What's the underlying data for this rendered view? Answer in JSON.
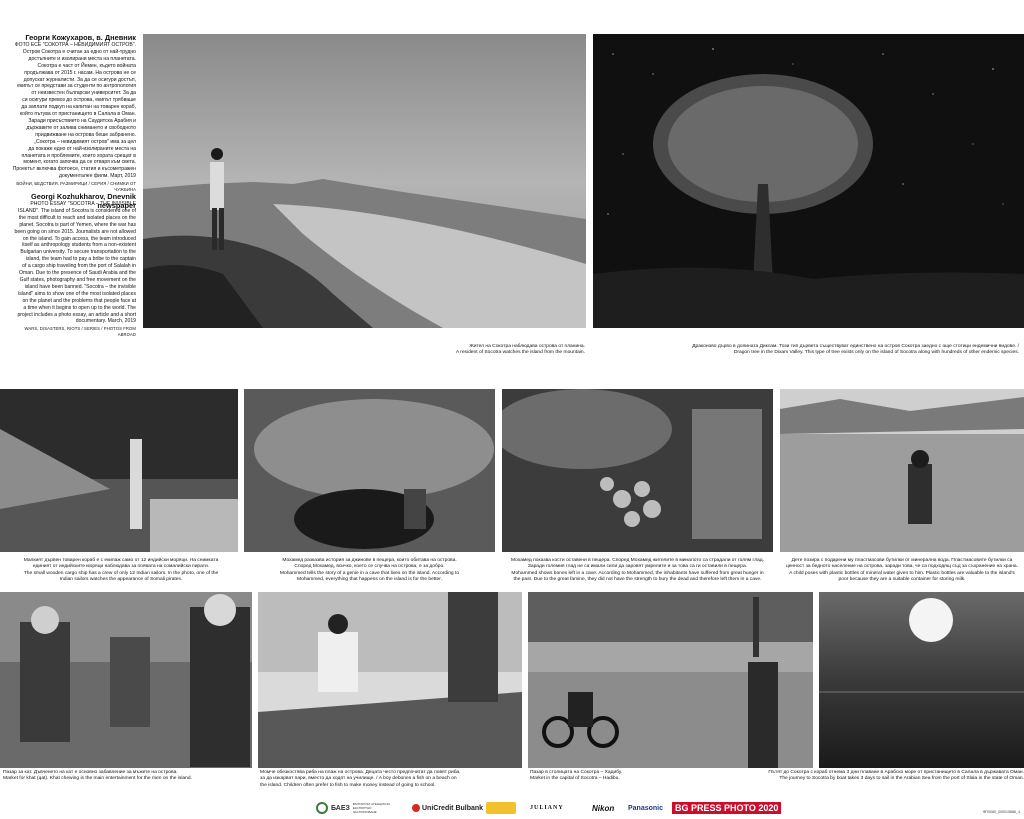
{
  "intro": {
    "bg_title": "Георги Кожухаров, в. Дневник",
    "bg_body": [
      "ФОТО ЕСЕ \"СОКОТРА – НЕВИДИМИЯТ ОСТРОВ\".",
      "Остров Сокотра е считан за едно от най-трудно",
      "достъпните и изолирани места на планетата.",
      "Сокотра е част от Йемен, където войната",
      "продължава от 2015 г. насам. На острова не се",
      "допускат журналисти. За да се осигури достъп,",
      "екипът се представи за студенти по антропология",
      "от неизвестен български университет. За да",
      "си осигури превоз до острова, екипът трябваше",
      "да заплати подкуп на капитан на товарен кораб,",
      "който пътува от пристанището в Салала в Оман.",
      "Заради присъствието на Саудитска Арабия и",
      "държавите от залива снимането и свободното",
      "придвижване на острова беше забранено.",
      "„Сокотра – невидимият остров\" има за цел",
      "да покаже едно от най-изолираните места на",
      "планетата и проблемите, които хората срещат в",
      "момент, когато започва да се отваря към света.",
      "Проектът включва фотоесе, статия и късометражен",
      "документален филм. Март, 2019"
    ],
    "bg_tags": "ВОЙНИ, БЕДСТВИЯ, РАЗМИРИЦИ / СЕРИЯ / СНИМКИ ОТ ЧУЖБИНА",
    "en_title": "Georgi Kozhukharov, Dnevnik newspaper",
    "en_body": [
      "PHOTO ESSAY \"SOCOTRA – THE INVISIBLE",
      "ISLAND\". The island of Socotra is considered one of",
      "the most difficult to reach and isolated places on the",
      "planet. Socotra is part of Yemen, where the war has",
      "been going on since 2015. Journalists are not allowed",
      "on the island. To gain access, the team introduced",
      "itself as anthropology students from a non-existent",
      "Bulgarian university. To secure transportation to the",
      "island, the team had to pay a bribe to the captain",
      "of a cargo ship traveling from the port of Salalah in",
      "Oman. Due to the presence of Saudi Arabia and the",
      "Gulf states, photography and free movement on the",
      "island have been banned. \"Socotra – the invisible",
      "island\" aims to show one of the most isolated places",
      "on the planet and the problems that people face at",
      "a time when it begins to open up to the world. The",
      "project includes a photo essay, an article and a short",
      "documentary. March, 2019"
    ],
    "en_tags": "WARS, DISASTERS, RIOTS / SERIES / PHOTOS FROM ABROAD"
  },
  "captions": {
    "c1": [
      "Жител на Сокотра наблюдава острова от планина.",
      "A resident of Socotra watches the island from the mountain."
    ],
    "c2": [
      "Драконово дърво в долината Диксам. Този тип дървета съществуват единствено на остров Сокотра заедно с още стотици ендемични видове. /",
      "Dragon tree in the Dixam Valley. This type of tree exists only on the island of Socotra along with hundreds of other endemic species."
    ],
    "c3": [
      "Малкият дървен товарен кораб е с екипаж само от 12 индийски моряци. На снимката",
      "единият от индийските моряци наблюдава за появата на сомалийски пирати.",
      "The small wooden cargo ship has a crew of only 12 Indian sailors. In the photo, one of the",
      "Indian sailors watches the appearance of Somali pirates."
    ],
    "c4": [
      "Мохамед разказва история за джинове в пещера, които обитава на острова.",
      "Според Мохамед, всичко, което се случва на острова, е за добро.",
      "Mohammed tells the story of a genie in a cave that lives on the island. According to",
      "Mohammed, everything that happens on the island is for the better."
    ],
    "c5": [
      "Мохамед показва кости оставени в пещера. Според Мохамед жителите в миналото са страдали от голям глад.",
      "Заради големия глад не са имали сили да заровят умрелите и за това са ги оставили в пещера.",
      "Mohammed shows bones left in a cave. According to Mohammed, the inhabitants have suffered from great hunger in",
      "the past. Due to the great famine, they did not have the strength to bury the dead and therefore left them in a cave."
    ],
    "c6": [
      "Дете позира с подарени му пластмасови бутилки от минерална вода. Пластмасовите бутилки са",
      "ценност за бедното население на острова, заради това, че са подходящ съд за съхранение на храна.",
      "A child poses with plastic bottles of mineral water given to him. Plastic bottles are valuable to the island's",
      "poor because they are a suitable container for storing milk."
    ],
    "c7": [
      "Пазар за кат. Дъвченето на кат е основно забавление за мъжете на острова.",
      "Market for khat (qat). Khat chewing is the main entertainment for the men on the island."
    ],
    "c8": [
      "Момче обезкостява риба на плаж на острова. Децата често предпочитат да ловят риба,",
      "за да изкарват пари, вместо да ходят на училище. / A boy debones a fish on a beach on",
      "the island. Children often prefer to fish to make money instead of going to school."
    ],
    "c9": [
      "Пазар в столицата на Сокотра – Хадибу.",
      "Market in the capital of Socotra – Hadibu."
    ],
    "c10": [
      "Пътят до Сокотра с кораб отнема 3 дни плаване в Арабско море от пристанището в Салала в държавата Оман.",
      "The journey to Socotra by boat takes 3 days to sail in the Arabian Sea from the port of Slala in the state of Oman."
    ]
  },
  "sponsors": {
    "baez": "БАЕЗ",
    "baez_sub": "БЪЛГАРСКА АГЕНЦИЯ ЗА ЕКСПОРТНО ЗАСТРАХОВАНЕ",
    "unicredit": "UniCredit Bulbank",
    "juliany": "JULIANY",
    "nikon": "Nikon",
    "panasonic": "Panasonic",
    "bgpress": "BG PRESS PHOTO 2020"
  },
  "page_code": "ФП0080_000015686_4"
}
